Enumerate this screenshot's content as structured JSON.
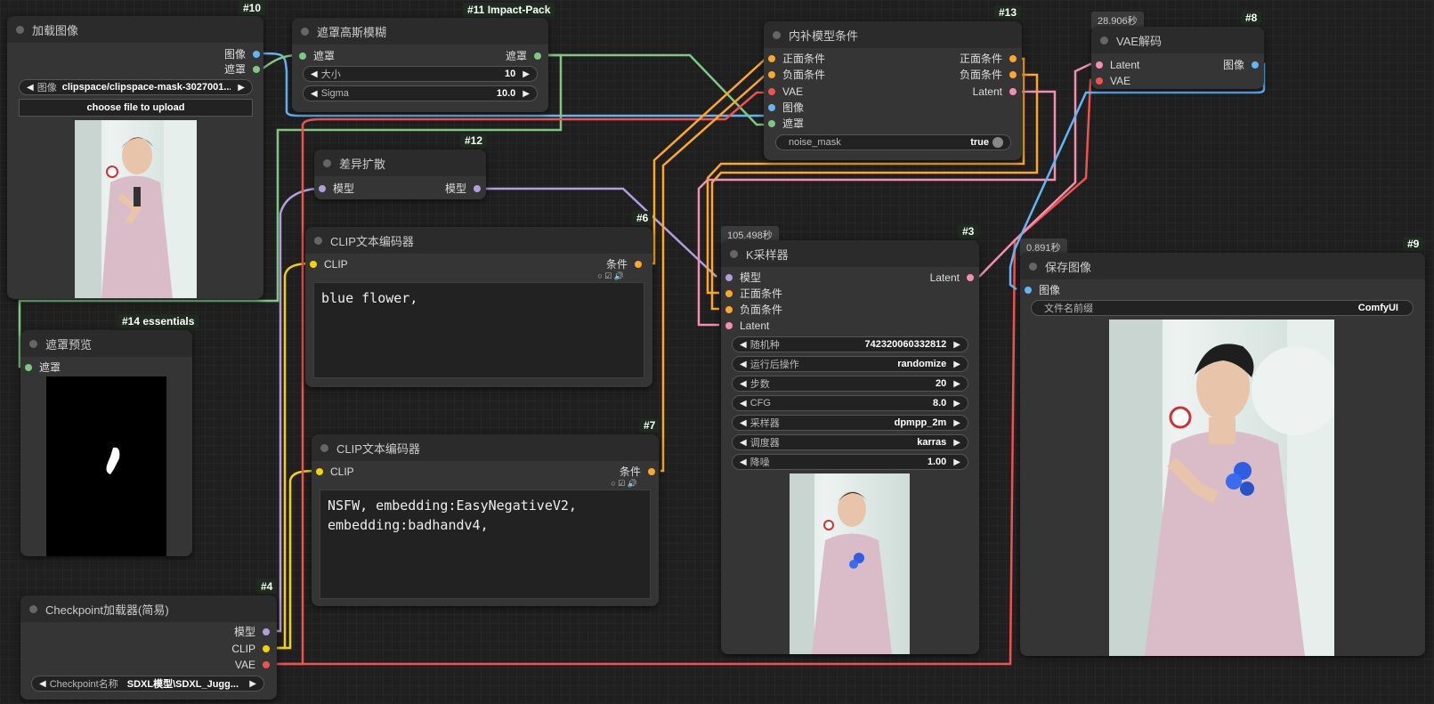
{
  "nodes": {
    "load_image": {
      "id": "#10",
      "title": "加载图像",
      "outputs": [
        "图像",
        "遮罩"
      ],
      "image_widget": {
        "label": "图像",
        "value": "clipspace/clipspace-mask-3027001..."
      },
      "upload_button": "choose file to upload"
    },
    "mask_blur": {
      "id": "#11 Impact-Pack",
      "title": "遮罩高斯模糊",
      "input": "遮罩",
      "output": "遮罩",
      "widgets": [
        {
          "label": "大小",
          "value": "10"
        },
        {
          "label": "Sigma",
          "value": "10.0"
        }
      ]
    },
    "diff_diffusion": {
      "id": "#12",
      "title": "差异扩散",
      "input": "模型",
      "output": "模型"
    },
    "inpaint_cond": {
      "id": "#13",
      "title": "内补模型条件",
      "inputs": [
        "正面条件",
        "负面条件",
        "VAE",
        "图像",
        "遮罩"
      ],
      "outputs": [
        "正面条件",
        "负面条件",
        "Latent"
      ],
      "toggle": {
        "label": "noise_mask",
        "value": "true"
      }
    },
    "vae_decode": {
      "id": "#8",
      "title": "VAE解码",
      "time": "28.906秒",
      "inputs": [
        "Latent",
        "VAE"
      ],
      "output": "图像"
    },
    "mask_preview": {
      "id": "#14 essentials",
      "title": "遮罩预览",
      "input": "遮罩"
    },
    "clip_pos": {
      "id": "#6",
      "title": "CLIP文本编码器",
      "input": "CLIP",
      "output": "条件",
      "text": "blue flower,"
    },
    "clip_neg": {
      "id": "#7",
      "title": "CLIP文本编码器",
      "input": "CLIP",
      "output": "条件",
      "text": "NSFW, embedding:EasyNegativeV2,\nembedding:badhandv4,"
    },
    "ksampler": {
      "id": "#3",
      "title": "K采样器",
      "time": "105.498秒",
      "inputs": [
        "模型",
        "正面条件",
        "负面条件",
        "Latent"
      ],
      "output": "Latent",
      "widgets": [
        {
          "label": "随机种",
          "value": "742320060332812"
        },
        {
          "label": "运行后操作",
          "value": "randomize"
        },
        {
          "label": "步数",
          "value": "20"
        },
        {
          "label": "CFG",
          "value": "8.0"
        },
        {
          "label": "采样器",
          "value": "dpmpp_2m"
        },
        {
          "label": "调度器",
          "value": "karras"
        },
        {
          "label": "降噪",
          "value": "1.00"
        }
      ]
    },
    "save_image": {
      "id": "#9",
      "title": "保存图像",
      "time": "0.891秒",
      "input": "图像",
      "widget": {
        "label": "文件名前缀",
        "value": "ComfyUI"
      }
    },
    "checkpoint": {
      "id": "#4",
      "title": "Checkpoint加载器(简易)",
      "outputs": [
        "模型",
        "CLIP",
        "VAE"
      ],
      "widget": {
        "label": "Checkpoint名称",
        "value": "SDXL模型\\SDXL_Jugg..."
      }
    }
  },
  "colors": {
    "model": "#b39ddb",
    "clip": "#f5d300",
    "vae": "#ef5350",
    "conditioning": "#ffa726",
    "latent": "#f48fb1",
    "mask": "#81c784",
    "image": "#64b5f6"
  }
}
